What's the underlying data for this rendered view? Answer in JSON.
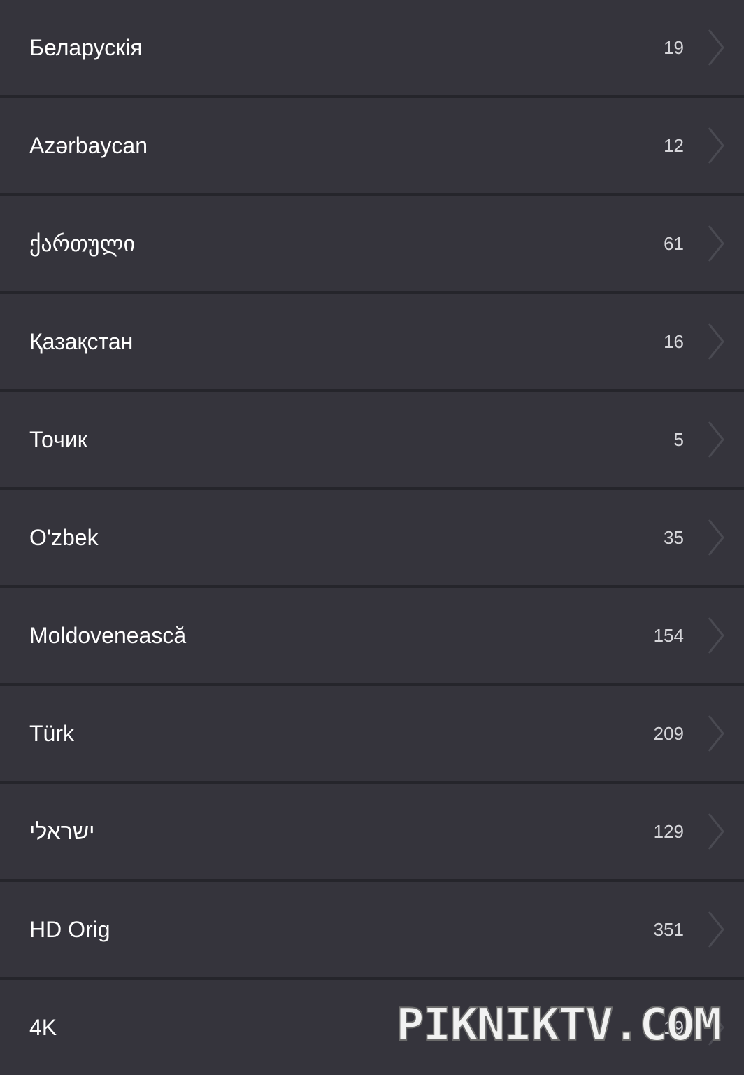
{
  "items": [
    {
      "label": "Беларускія",
      "count": "19"
    },
    {
      "label": "Azərbaycan",
      "count": "12"
    },
    {
      "label": "ქართული",
      "count": "61"
    },
    {
      "label": "Қазақстан",
      "count": "16"
    },
    {
      "label": "Точик",
      "count": "5"
    },
    {
      "label": "O'zbek",
      "count": "35"
    },
    {
      "label": "Moldovenească",
      "count": "154"
    },
    {
      "label": "Türk",
      "count": "209"
    },
    {
      "label": "ישראלי",
      "count": "129"
    },
    {
      "label": "HD Orig",
      "count": "351"
    },
    {
      "label": "4K",
      "count": "19"
    }
  ],
  "icons": {
    "row_arrow": "chevron-right-icon"
  },
  "watermark": {
    "text": "PIKNIKTV.COM"
  },
  "colors": {
    "row_background": "#35343c",
    "separator": "#25252b",
    "label_text": "#ffffff",
    "count_text": "#d6d6da",
    "chevron": "#4a4a52"
  }
}
